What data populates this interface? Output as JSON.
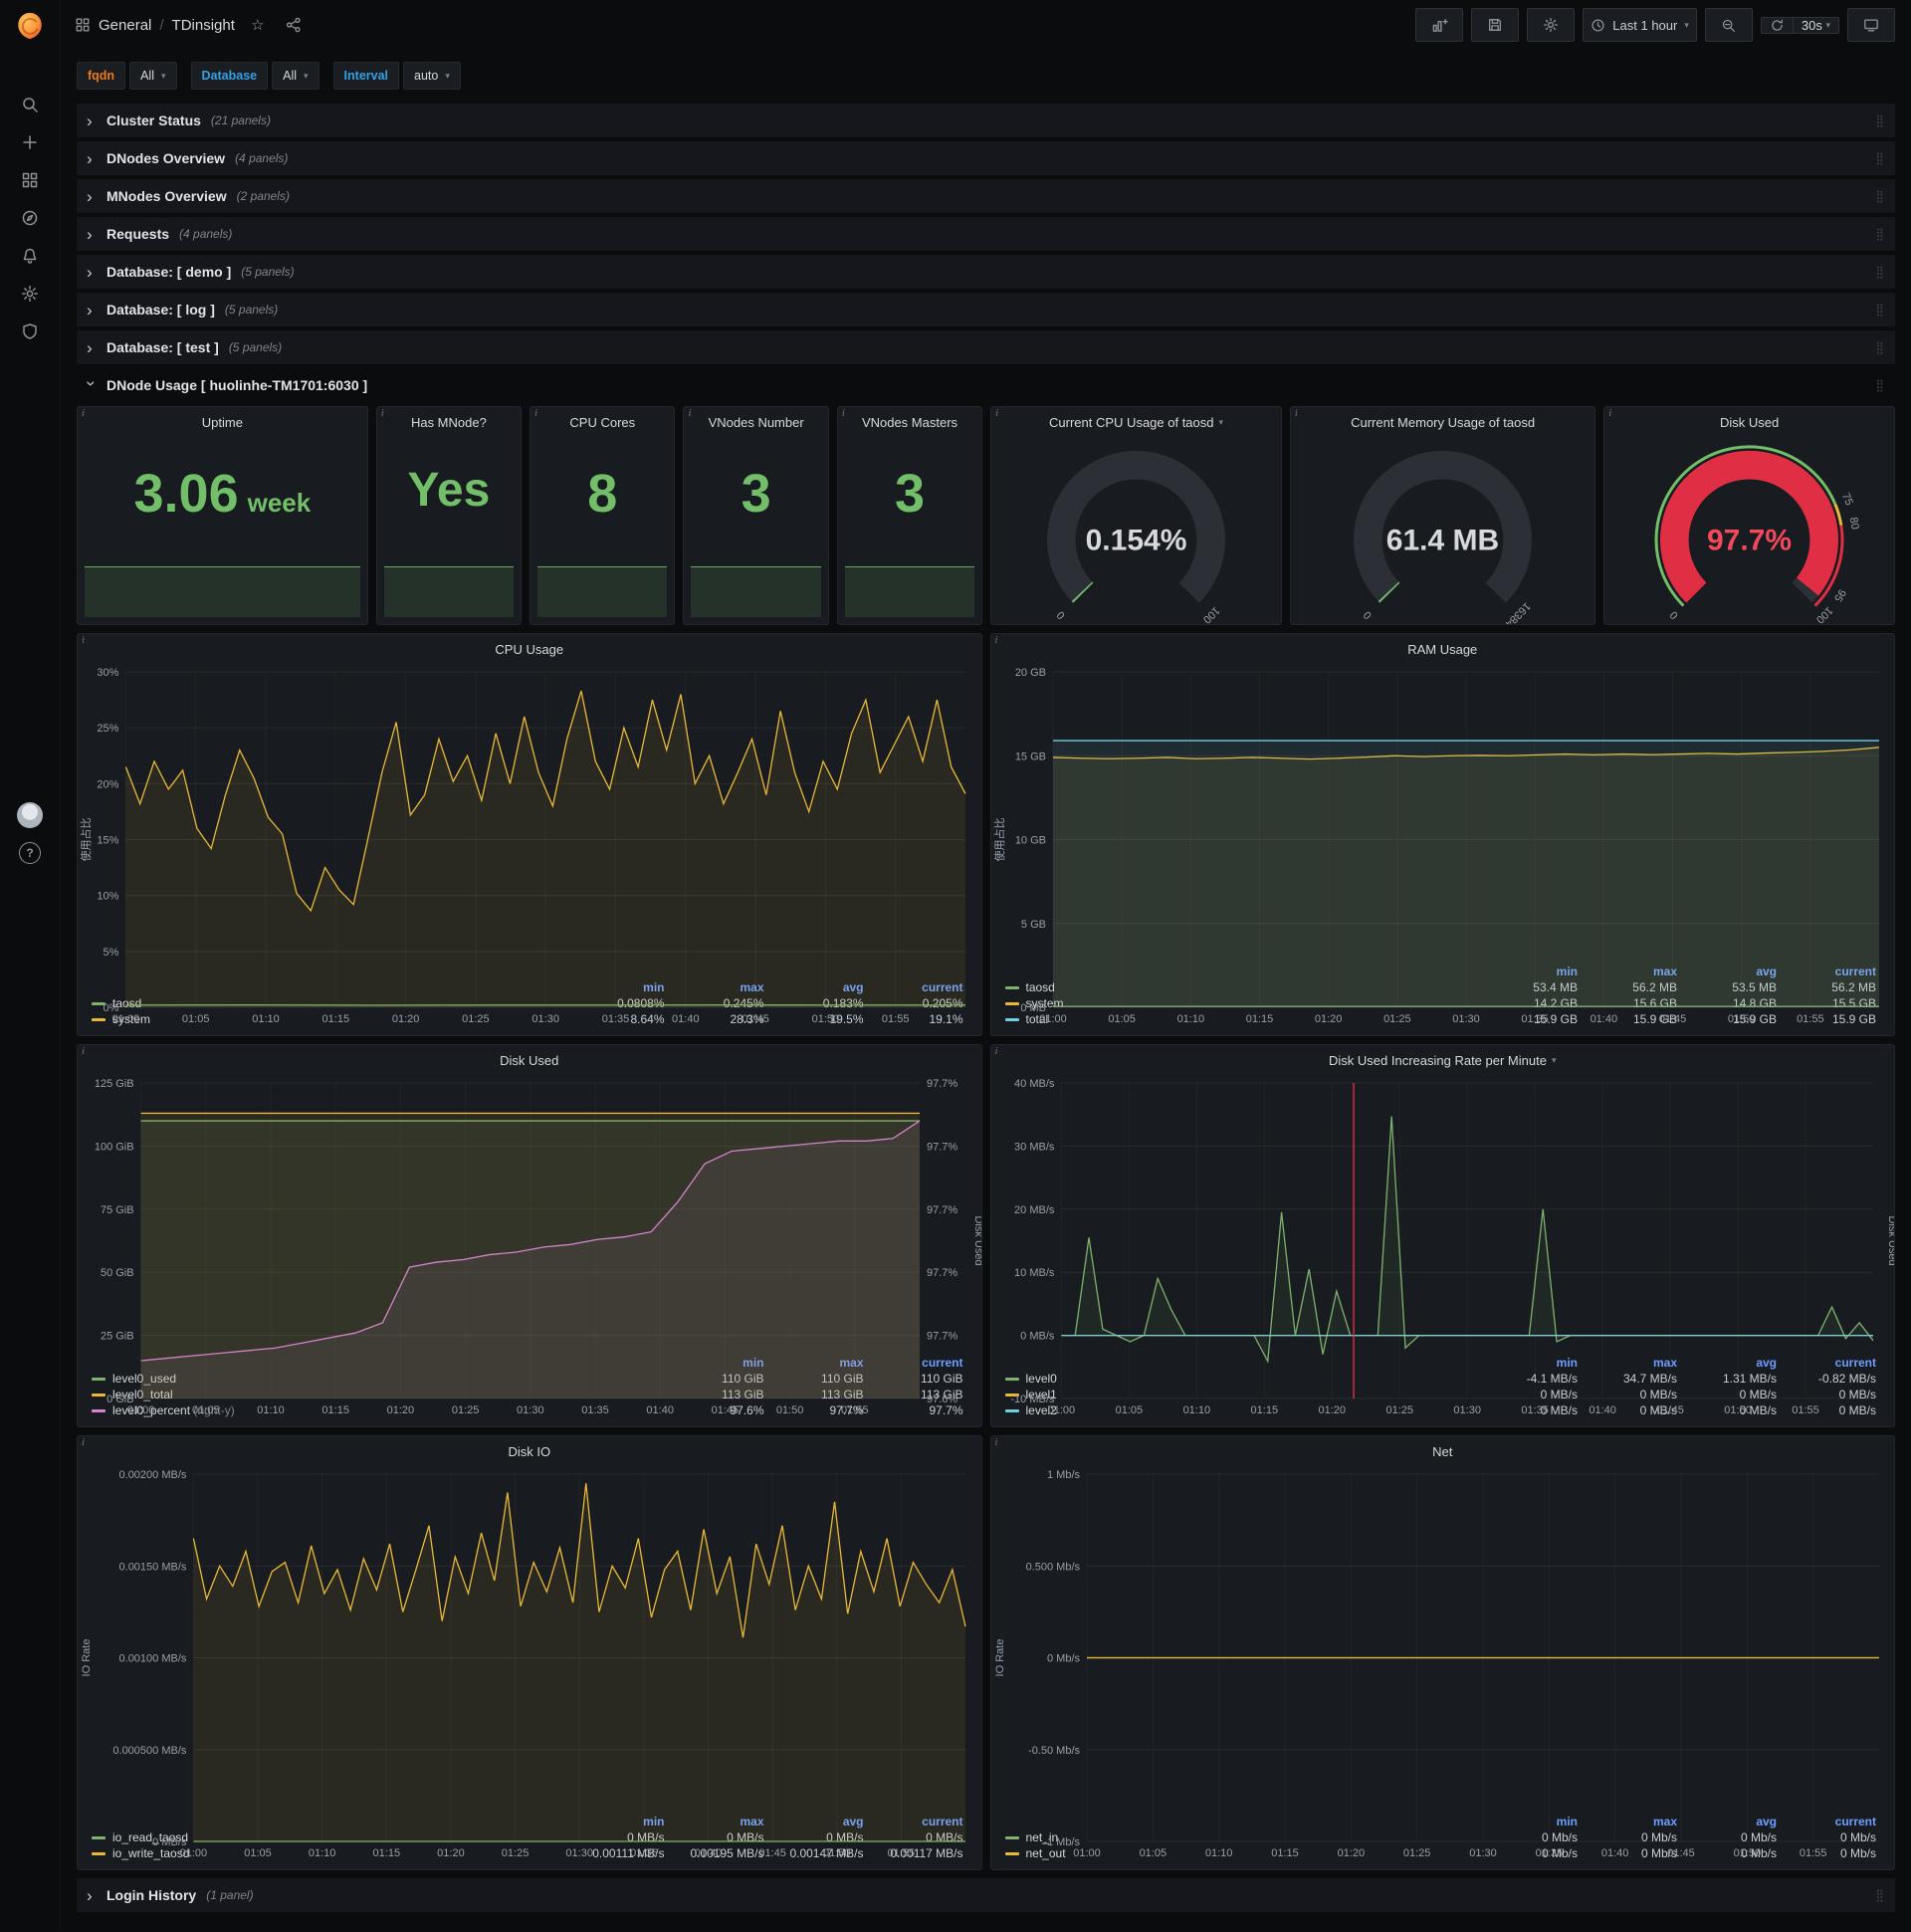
{
  "nav": {
    "breadcrumb": {
      "section": "General",
      "sep": "/",
      "title": "TDinsight"
    },
    "time_range": "Last 1 hour",
    "refresh": "30s"
  },
  "variables": {
    "fqdn_label": "fqdn",
    "fqdn_value": "All",
    "db_label": "Database",
    "db_value": "All",
    "interval_label": "Interval",
    "interval_value": "auto"
  },
  "collapsed_rows": [
    {
      "title": "Cluster Status",
      "count": "(21 panels)"
    },
    {
      "title": "DNodes Overview",
      "count": "(4 panels)"
    },
    {
      "title": "MNodes Overview",
      "count": "(2 panels)"
    },
    {
      "title": "Requests",
      "count": "(4 panels)"
    },
    {
      "title": "Database: [ demo ]",
      "count": "(5 panels)"
    },
    {
      "title": "Database: [ log ]",
      "count": "(5 panels)"
    },
    {
      "title": "Database: [ test ]",
      "count": "(5 panels)"
    }
  ],
  "dnode_row": {
    "title": "DNode Usage [ huolinhe-TM1701:6030 ]"
  },
  "login_row": {
    "title": "Login History",
    "count": "(1 panel)"
  },
  "stats": [
    {
      "title": "Uptime",
      "value": "3.06",
      "unit": "week"
    },
    {
      "title": "Has MNode?",
      "value": "Yes",
      "unit": ""
    },
    {
      "title": "CPU Cores",
      "value": "8",
      "unit": ""
    },
    {
      "title": "VNodes Number",
      "value": "3",
      "unit": ""
    },
    {
      "title": "VNodes Masters",
      "value": "3",
      "unit": ""
    }
  ],
  "gauges": [
    {
      "title": "Current CPU Usage of taosd",
      "caret": "▾",
      "display": "0.154%",
      "value": 0.154,
      "min": 0,
      "max": 100,
      "bar_color": "#73bf69",
      "value_color": "#d8d9da",
      "labels": [
        {
          "v": 0,
          "t": "0"
        },
        {
          "v": 100,
          "t": "100"
        }
      ]
    },
    {
      "title": "Current Memory Usage of taosd",
      "display": "61.4 MB",
      "value": 61.4,
      "min": 0,
      "max": 16384,
      "bar_color": "#73bf69",
      "value_color": "#d8d9da",
      "labels": [
        {
          "v": 0,
          "t": "0"
        },
        {
          "v": 16384,
          "t": "16384"
        }
      ]
    },
    {
      "title": "Disk Used",
      "display": "97.7%",
      "value": 97.7,
      "min": 0,
      "max": 100,
      "bar_color": "#e02f44",
      "value_color": "#f2495c",
      "labels": [
        {
          "v": 0,
          "t": "0"
        },
        {
          "v": 75,
          "t": "75"
        },
        {
          "v": 80,
          "t": "80"
        },
        {
          "v": 95,
          "t": "95"
        },
        {
          "v": 100,
          "t": "100"
        }
      ],
      "ring": [
        {
          "to": 75,
          "color": "#73bf69"
        },
        {
          "to": 80,
          "color": "#eab839"
        },
        {
          "to": 100,
          "color": "#e02f44"
        }
      ]
    }
  ],
  "chart_data": {
    "cpu": {
      "type": "line",
      "title": "CPU Usage",
      "ylabel": "使用占比",
      "y_min": 0,
      "y_max": 30,
      "y_ticks": [
        {
          "v": 30,
          "t": "30%"
        },
        {
          "v": 25,
          "t": "25%"
        },
        {
          "v": 20,
          "t": "20%"
        },
        {
          "v": 15,
          "t": "15%"
        },
        {
          "v": 10,
          "t": "10%"
        },
        {
          "v": 5,
          "t": "5%"
        },
        {
          "v": 0,
          "t": "0%"
        }
      ],
      "x_ticks": [
        "01:00",
        "01:05",
        "01:10",
        "01:15",
        "01:20",
        "01:25",
        "01:30",
        "01:35",
        "01:40",
        "01:45",
        "01:50",
        "01:55"
      ],
      "series": [
        {
          "name": "taosd",
          "color": "#7eb26d",
          "values": [
            0.2,
            0.21,
            0.19,
            0.2,
            0.2,
            0.21,
            0.2,
            0.2
          ]
        },
        {
          "name": "system",
          "color": "#eab839",
          "values": [
            21.5,
            18.2,
            22,
            19.5,
            21.2,
            16,
            14.2,
            19,
            23,
            20.5,
            17,
            15.5,
            10.2,
            8.64,
            12.5,
            10.5,
            9.2,
            15,
            21,
            25.5,
            17.2,
            19,
            24,
            20.2,
            22.5,
            18.5,
            24.5,
            20,
            26,
            21,
            18,
            24,
            28.3,
            22,
            19.5,
            25,
            21.5,
            27.5,
            23,
            28,
            20,
            22.5,
            18.2,
            21,
            24,
            19,
            26.5,
            21,
            17.5,
            22,
            19.5,
            24.5,
            27.5,
            21,
            23.5,
            26,
            22,
            27.5,
            21.5,
            19.1
          ]
        }
      ],
      "legend": {
        "headers": [
          "min",
          "max",
          "avg",
          "current"
        ],
        "rows": [
          {
            "name": "taosd",
            "color": "#7eb26d",
            "values": [
              "0.0808%",
              "0.245%",
              "0.183%",
              "0.205%"
            ]
          },
          {
            "name": "system",
            "color": "#eab839",
            "values": [
              "8.64%",
              "28.3%",
              "19.5%",
              "19.1%"
            ]
          }
        ]
      }
    },
    "ram": {
      "type": "line",
      "title": "RAM Usage",
      "ylabel": "使用占比",
      "y_min": 0,
      "y_max": 20,
      "y_ticks": [
        {
          "v": 20,
          "t": "20 GB"
        },
        {
          "v": 15,
          "t": "15 GB"
        },
        {
          "v": 10,
          "t": "10 GB"
        },
        {
          "v": 5,
          "t": "5 GB"
        },
        {
          "v": 0,
          "t": "0 MB"
        }
      ],
      "x_ticks": [
        "01:00",
        "01:05",
        "01:10",
        "01:15",
        "01:20",
        "01:25",
        "01:30",
        "01:35",
        "01:40",
        "01:45",
        "01:50",
        "01:55"
      ],
      "series": [
        {
          "name": "taosd",
          "color": "#7eb26d",
          "values": [
            0.053,
            0.053
          ]
        },
        {
          "name": "system",
          "color": "#eab839",
          "values": [
            14.9,
            14.85,
            14.82,
            14.85,
            14.9,
            14.82,
            14.85,
            14.9,
            14.85,
            14.8,
            14.85,
            14.92,
            15.0,
            14.95,
            15.0,
            15.02,
            15.0,
            15.05,
            15.1,
            15.05,
            15.1,
            15.06,
            15.1,
            15.14,
            15.1,
            15.16,
            15.2,
            15.26,
            15.35,
            15.5
          ]
        },
        {
          "name": "total",
          "color": "#6ed0e0",
          "values": [
            15.9,
            15.9
          ]
        }
      ],
      "legend": {
        "headers": [
          "min",
          "max",
          "avg",
          "current"
        ],
        "rows": [
          {
            "name": "taosd",
            "color": "#7eb26d",
            "values": [
              "53.4 MB",
              "56.2 MB",
              "53.5 MB",
              "56.2 MB"
            ]
          },
          {
            "name": "system",
            "color": "#eab839",
            "values": [
              "14.2 GB",
              "15.6 GB",
              "14.8 GB",
              "15.5 GB"
            ]
          },
          {
            "name": "total",
            "color": "#6ed0e0",
            "values": [
              "15.9 GB",
              "15.9 GB",
              "15.9 GB",
              "15.9 GB"
            ]
          }
        ]
      }
    },
    "disk": {
      "type": "line",
      "title": "Disk Used",
      "y_min": 0,
      "y_max": 125,
      "y_ticks": [
        {
          "v": 125,
          "t": "125 GiB"
        },
        {
          "v": 100,
          "t": "100 GiB"
        },
        {
          "v": 75,
          "t": "75 GiB"
        },
        {
          "v": 50,
          "t": "50 GiB"
        },
        {
          "v": 25,
          "t": "25 GiB"
        },
        {
          "v": 0,
          "t": "0 GiB"
        }
      ],
      "y2_min": 97.6,
      "y2_max": 97.725,
      "y2_label": "Disk Used",
      "y2_ticks": [
        {
          "v": 97.725,
          "t": "97.7%"
        },
        {
          "v": 97.7,
          "t": "97.7%"
        },
        {
          "v": 97.675,
          "t": "97.7%"
        },
        {
          "v": 97.65,
          "t": "97.7%"
        },
        {
          "v": 97.625,
          "t": "97.7%"
        },
        {
          "v": 97.6,
          "t": "97.6%"
        }
      ],
      "x_ticks": [
        "01:00",
        "01:05",
        "01:10",
        "01:15",
        "01:20",
        "01:25",
        "01:30",
        "01:35",
        "01:40",
        "01:45",
        "01:50",
        "01:55"
      ],
      "series": [
        {
          "name": "level0_used",
          "color": "#7eb26d",
          "values": [
            110,
            110
          ]
        },
        {
          "name": "level0_total",
          "color": "#eab839",
          "values": [
            113,
            113
          ]
        },
        {
          "name": "level0_percent",
          "color": "#d683ce",
          "axis": "right",
          "values": [
            97.615,
            97.616,
            97.617,
            97.618,
            97.619,
            97.62,
            97.622,
            97.624,
            97.626,
            97.63,
            97.652,
            97.654,
            97.655,
            97.657,
            97.658,
            97.66,
            97.661,
            97.663,
            97.664,
            97.666,
            97.678,
            97.693,
            97.698,
            97.699,
            97.7,
            97.701,
            97.702,
            97.702,
            97.703,
            97.71
          ]
        }
      ],
      "legend": {
        "headers": [
          "min",
          "max",
          "current"
        ],
        "rows": [
          {
            "name": "level0_used",
            "color": "#7eb26d",
            "values": [
              "110 GiB",
              "110 GiB",
              "110 GiB"
            ]
          },
          {
            "name": "level0_total",
            "color": "#eab839",
            "values": [
              "113 GiB",
              "113 GiB",
              "113 GiB"
            ]
          },
          {
            "name": "level0_percent",
            "color": "#d683ce",
            "suffix": "(right-y)",
            "values": [
              "97.6%",
              "97.7%",
              "97.7%"
            ]
          }
        ]
      }
    },
    "disk_rate": {
      "type": "line",
      "title": "Disk Used Increasing Rate per Minute",
      "caret": "▾",
      "y_min": -10,
      "y_max": 40,
      "y_ticks": [
        {
          "v": 40,
          "t": "40 MB/s"
        },
        {
          "v": 30,
          "t": "30 MB/s"
        },
        {
          "v": 20,
          "t": "20 MB/s"
        },
        {
          "v": 10,
          "t": "10 MB/s"
        },
        {
          "v": 0,
          "t": "0 MB/s"
        },
        {
          "v": -10,
          "t": "-10 MB/s"
        }
      ],
      "y2_label": "Disk Used",
      "x_ticks": [
        "01:00",
        "01:05",
        "01:10",
        "01:15",
        "01:20",
        "01:25",
        "01:30",
        "01:35",
        "01:40",
        "01:45",
        "01:50",
        "01:55"
      ],
      "annotation_frac": 0.36,
      "annotation_color": "#e02f44",
      "series": [
        {
          "name": "level0",
          "color": "#7eb26d",
          "values": [
            0,
            0,
            15.5,
            1,
            0,
            -1,
            0,
            9,
            4,
            0,
            0,
            0,
            0,
            0,
            0,
            -4.1,
            19.5,
            0,
            10.5,
            -3,
            7,
            0,
            0,
            0,
            34.7,
            -2,
            0,
            0,
            0,
            0,
            0,
            0,
            0,
            0,
            0,
            20,
            -1,
            0,
            0,
            0,
            0,
            0,
            0,
            0,
            0,
            0,
            0,
            0,
            0,
            0,
            0,
            0,
            0,
            0,
            0,
            0,
            4.5,
            -0.5,
            2,
            -0.82
          ]
        },
        {
          "name": "level1",
          "color": "#eab839",
          "values": [
            0,
            0
          ]
        },
        {
          "name": "level2",
          "color": "#6ed0e0",
          "values": [
            0,
            0
          ]
        }
      ],
      "legend": {
        "headers": [
          "min",
          "max",
          "avg",
          "current"
        ],
        "rows": [
          {
            "name": "level0",
            "color": "#7eb26d",
            "values": [
              "-4.1 MB/s",
              "34.7 MB/s",
              "1.31 MB/s",
              "-0.82 MB/s"
            ]
          },
          {
            "name": "level1",
            "color": "#eab839",
            "values": [
              "0 MB/s",
              "0 MB/s",
              "0 MB/s",
              "0 MB/s"
            ]
          },
          {
            "name": "level2",
            "color": "#6ed0e0",
            "values": [
              "0 MB/s",
              "0 MB/s",
              "0 MB/s",
              "0 MB/s"
            ]
          }
        ]
      }
    },
    "disk_io": {
      "type": "line",
      "title": "Disk IO",
      "ylabel": "IO Rate",
      "y_min": 0,
      "y_max": 0.002,
      "y_ticks": [
        {
          "v": 0.002,
          "t": "0.00200 MB/s"
        },
        {
          "v": 0.0015,
          "t": "0.00150 MB/s"
        },
        {
          "v": 0.001,
          "t": "0.00100 MB/s"
        },
        {
          "v": 0.0005,
          "t": "0.000500 MB/s"
        },
        {
          "v": 0,
          "t": "0 MB/s"
        }
      ],
      "x_ticks": [
        "01:00",
        "01:05",
        "01:10",
        "01:15",
        "01:20",
        "01:25",
        "01:30",
        "01:35",
        "01:40",
        "01:45",
        "01:50",
        "01:55"
      ],
      "series": [
        {
          "name": "io_read_taosd",
          "color": "#7eb26d",
          "values": [
            0,
            0
          ]
        },
        {
          "name": "io_write_taosd",
          "color": "#eab839",
          "values": [
            0.00165,
            0.00132,
            0.0015,
            0.00139,
            0.00158,
            0.00128,
            0.00147,
            0.00152,
            0.0013,
            0.00161,
            0.00135,
            0.00148,
            0.00126,
            0.00154,
            0.00137,
            0.00162,
            0.00125,
            0.00148,
            0.00172,
            0.0012,
            0.00155,
            0.00135,
            0.00168,
            0.00142,
            0.0019,
            0.00128,
            0.00152,
            0.00136,
            0.0016,
            0.0013,
            0.00195,
            0.00125,
            0.0015,
            0.00138,
            0.00165,
            0.00122,
            0.00148,
            0.00158,
            0.00126,
            0.0017,
            0.00135,
            0.00155,
            0.00111,
            0.00162,
            0.0014,
            0.00172,
            0.00126,
            0.0015,
            0.00132,
            0.00185,
            0.00124,
            0.00158,
            0.00136,
            0.00165,
            0.00128,
            0.00152,
            0.0014,
            0.0013,
            0.00148,
            0.00117
          ]
        }
      ],
      "legend": {
        "headers": [
          "min",
          "max",
          "avg",
          "current"
        ],
        "rows": [
          {
            "name": "io_read_taosd",
            "color": "#7eb26d",
            "values": [
              "0 MB/s",
              "0 MB/s",
              "0 MB/s",
              "0 MB/s"
            ]
          },
          {
            "name": "io_write_taosd",
            "color": "#eab839",
            "values": [
              "0.00111 MB/s",
              "0.00195 MB/s",
              "0.00147 MB/s",
              "0.00117 MB/s"
            ]
          }
        ]
      }
    },
    "net": {
      "type": "line",
      "title": "Net",
      "ylabel": "IO Rate",
      "y_min": -1,
      "y_max": 1,
      "y_ticks": [
        {
          "v": 1,
          "t": "1 Mb/s"
        },
        {
          "v": 0.5,
          "t": "0.500 Mb/s"
        },
        {
          "v": 0,
          "t": "0 Mb/s"
        },
        {
          "v": -0.5,
          "t": "-0.50 Mb/s"
        },
        {
          "v": -1,
          "t": "-1 Mb/s"
        }
      ],
      "x_ticks": [
        "01:00",
        "01:05",
        "01:10",
        "01:15",
        "01:20",
        "01:25",
        "01:30",
        "01:35",
        "01:40",
        "01:45",
        "01:50",
        "01:55"
      ],
      "series": [
        {
          "name": "net_in",
          "color": "#7eb26d",
          "values": [
            0,
            0
          ]
        },
        {
          "name": "net_out",
          "color": "#eab839",
          "values": [
            0,
            0
          ]
        }
      ],
      "legend": {
        "headers": [
          "min",
          "max",
          "avg",
          "current"
        ],
        "rows": [
          {
            "name": "net_in",
            "color": "#7eb26d",
            "values": [
              "0 Mb/s",
              "0 Mb/s",
              "0 Mb/s",
              "0 Mb/s"
            ]
          },
          {
            "name": "net_out",
            "color": "#eab839",
            "values": [
              "0 Mb/s",
              "0 Mb/s",
              "0 Mb/s",
              "0 Mb/s"
            ]
          }
        ]
      }
    }
  }
}
